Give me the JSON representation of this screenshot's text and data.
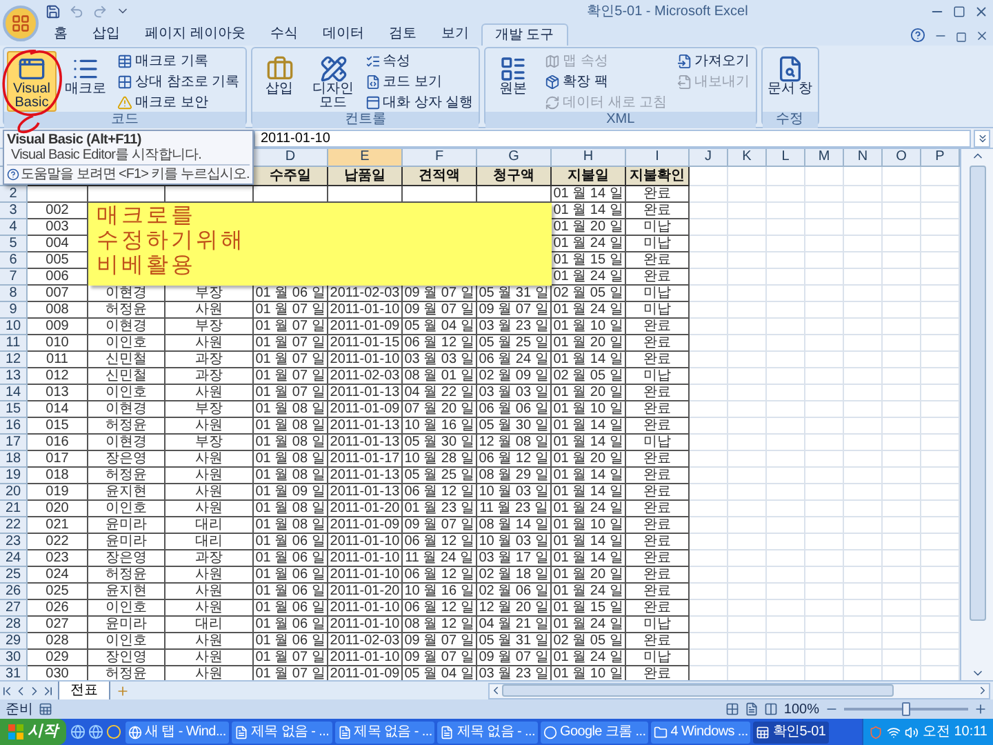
{
  "window": {
    "title": "확인5-01 - Microsoft Excel"
  },
  "ribbon_tabs": [
    {
      "label": "홈",
      "selected": false
    },
    {
      "label": "삽입",
      "selected": false
    },
    {
      "label": "페이지 레이아웃",
      "selected": false
    },
    {
      "label": "수식",
      "selected": false
    },
    {
      "label": "데이터",
      "selected": false
    },
    {
      "label": "검토",
      "selected": false
    },
    {
      "label": "보기",
      "selected": false
    },
    {
      "label": "개발 도구",
      "selected": true
    }
  ],
  "ribbon_groups": [
    {
      "label": "코드",
      "items": [
        {
          "kind": "large",
          "label": "Visual Basic",
          "hovered": true,
          "disabled": false
        },
        {
          "kind": "large",
          "label": "매크로",
          "hovered": false,
          "disabled": false
        },
        {
          "kind": "small",
          "label": "매크로 기록",
          "hovered": false,
          "disabled": false
        },
        {
          "kind": "small",
          "label": "상대 참조로 기록",
          "hovered": false,
          "disabled": false
        },
        {
          "kind": "small",
          "label": "매크로 보안",
          "hovered": false,
          "disabled": false
        }
      ]
    },
    {
      "label": "컨트롤",
      "items": [
        {
          "kind": "large",
          "label": "삽입",
          "hovered": false,
          "disabled": false
        },
        {
          "kind": "large",
          "label": "디자인 모드",
          "hovered": false,
          "disabled": false
        },
        {
          "kind": "small",
          "label": "속성",
          "hovered": false,
          "disabled": false
        },
        {
          "kind": "small",
          "label": "코드 보기",
          "hovered": false,
          "disabled": false
        },
        {
          "kind": "small",
          "label": "대화 상자 실행",
          "hovered": false,
          "disabled": false
        }
      ]
    },
    {
      "label": "XML",
      "items": [
        {
          "kind": "large",
          "label": "원본",
          "hovered": false,
          "disabled": false
        },
        {
          "kind": "small",
          "label": "맵 속성",
          "hovered": false,
          "disabled": true
        },
        {
          "kind": "small",
          "label": "확장 팩",
          "hovered": false,
          "disabled": false
        },
        {
          "kind": "small",
          "label": "데이터 새로 고침",
          "hovered": false,
          "disabled": true
        },
        {
          "kind": "small",
          "label": "가져오기",
          "hovered": false,
          "disabled": false
        },
        {
          "kind": "small",
          "label": "내보내기",
          "hovered": false,
          "disabled": true
        }
      ]
    },
    {
      "label": "수정",
      "items": [
        {
          "kind": "large",
          "label": "문서 창",
          "hovered": false,
          "disabled": false
        }
      ]
    }
  ],
  "tooltip": {
    "title": "Visual Basic (Alt+F11)",
    "description": "Visual Basic Editor를 시작합니다.",
    "help": "도움말을 보려면 <F1> 키를 누르십시오."
  },
  "formula_bar": {
    "value": "2011-01-10"
  },
  "column_headers": [
    {
      "label": "D",
      "selected": false
    },
    {
      "label": "E",
      "selected": true
    },
    {
      "label": "F",
      "selected": false
    },
    {
      "label": "G",
      "selected": false
    },
    {
      "label": "H",
      "selected": false
    },
    {
      "label": "I",
      "selected": false
    },
    {
      "label": "J",
      "selected": false
    },
    {
      "label": "K",
      "selected": false
    },
    {
      "label": "L",
      "selected": false
    },
    {
      "label": "M",
      "selected": false
    },
    {
      "label": "N",
      "selected": false
    },
    {
      "label": "O",
      "selected": false
    },
    {
      "label": "P",
      "selected": false
    }
  ],
  "table": {
    "columns": [
      "",
      "",
      "",
      "수주일",
      "납품일",
      "견적액",
      "청구액",
      "지불일",
      "지불확인"
    ],
    "rows": [
      {
        "number": "2",
        "cells": [
          null,
          null,
          null,
          null,
          null,
          null,
          null,
          "01 월 14 일",
          "완료"
        ]
      },
      {
        "number": "3",
        "cells": [
          "002",
          null,
          null,
          null,
          null,
          null,
          null,
          "01 월 14 일",
          "완료"
        ]
      },
      {
        "number": "4",
        "cells": [
          "003",
          null,
          null,
          null,
          null,
          null,
          null,
          "01 월 20 일",
          "미납"
        ]
      },
      {
        "number": "5",
        "cells": [
          "004",
          null,
          null,
          null,
          null,
          null,
          null,
          "01 월 24 일",
          "미납"
        ]
      },
      {
        "number": "6",
        "cells": [
          "005",
          null,
          null,
          null,
          null,
          null,
          null,
          "01 월 15 일",
          "완료"
        ]
      },
      {
        "number": "7",
        "cells": [
          "006",
          null,
          null,
          null,
          null,
          null,
          null,
          "01 월 24 일",
          "완료"
        ]
      },
      {
        "number": "8",
        "cells": [
          "007",
          "이현경",
          "부장",
          "01 월 06 일",
          "2011-02-03",
          "09 월 07 일",
          "05 월 31 일",
          "02 월 05 일",
          "미납"
        ]
      },
      {
        "number": "9",
        "cells": [
          "008",
          "허정윤",
          "사원",
          "01 월 07 일",
          "2011-01-10",
          "09 월 07 일",
          "09 월 07 일",
          "01 월 24 일",
          "미납"
        ]
      },
      {
        "number": "10",
        "cells": [
          "009",
          "이현경",
          "부장",
          "01 월 07 일",
          "2011-01-09",
          "05 월 04 일",
          "03 월 23 일",
          "01 월 10 일",
          "완료"
        ]
      },
      {
        "number": "11",
        "cells": [
          "010",
          "이인호",
          "사원",
          "01 월 07 일",
          "2011-01-15",
          "06 월 12 일",
          "05 월 25 일",
          "01 월 20 일",
          "완료"
        ]
      },
      {
        "number": "12",
        "cells": [
          "011",
          "신민철",
          "과장",
          "01 월 07 일",
          "2011-01-10",
          "03 월 03 일",
          "06 월 24 일",
          "01 월 14 일",
          "완료"
        ]
      },
      {
        "number": "13",
        "cells": [
          "012",
          "신민철",
          "과장",
          "01 월 07 일",
          "2011-02-03",
          "08 월 01 일",
          "02 월 09 일",
          "02 월 05 일",
          "미납"
        ]
      },
      {
        "number": "14",
        "cells": [
          "013",
          "이인호",
          "사원",
          "01 월 07 일",
          "2011-01-13",
          "04 월 22 일",
          "03 월 03 일",
          "01 월 20 일",
          "완료"
        ]
      },
      {
        "number": "15",
        "cells": [
          "014",
          "이현경",
          "부장",
          "01 월 08 일",
          "2011-01-09",
          "07 월 20 일",
          "06 월 06 일",
          "01 월 10 일",
          "완료"
        ]
      },
      {
        "number": "16",
        "cells": [
          "015",
          "허정윤",
          "사원",
          "01 월 08 일",
          "2011-01-13",
          "10 월 16 일",
          "05 월 30 일",
          "01 월 14 일",
          "완료"
        ]
      },
      {
        "number": "17",
        "cells": [
          "016",
          "이현경",
          "부장",
          "01 월 08 일",
          "2011-01-13",
          "05 월 30 일",
          "12 월 08 일",
          "01 월 14 일",
          "미납"
        ]
      },
      {
        "number": "18",
        "cells": [
          "017",
          "장은영",
          "사원",
          "01 월 08 일",
          "2011-01-17",
          "10 월 28 일",
          "06 월 12 일",
          "01 월 20 일",
          "완료"
        ]
      },
      {
        "number": "19",
        "cells": [
          "018",
          "허정윤",
          "사원",
          "01 월 08 일",
          "2011-01-13",
          "05 월 25 일",
          "08 월 29 일",
          "01 월 14 일",
          "완료"
        ]
      },
      {
        "number": "20",
        "cells": [
          "019",
          "윤지현",
          "사원",
          "01 월 09 일",
          "2011-01-13",
          "06 월 12 일",
          "10 월 03 일",
          "01 월 14 일",
          "완료"
        ]
      },
      {
        "number": "21",
        "cells": [
          "020",
          "이인호",
          "사원",
          "01 월 08 일",
          "2011-01-20",
          "01 월 23 일",
          "11 월 23 일",
          "01 월 24 일",
          "완료"
        ]
      },
      {
        "number": "22",
        "cells": [
          "021",
          "윤미라",
          "대리",
          "01 월 08 일",
          "2011-01-09",
          "09 월 07 일",
          "08 월 14 일",
          "01 월 10 일",
          "완료"
        ]
      },
      {
        "number": "23",
        "cells": [
          "022",
          "윤미라",
          "대리",
          "01 월 06 일",
          "2011-01-10",
          "06 월 12 일",
          "10 월 03 일",
          "01 월 14 일",
          "완료"
        ]
      },
      {
        "number": "24",
        "cells": [
          "023",
          "장은영",
          "과장",
          "01 월 06 일",
          "2011-01-10",
          "11 월 24 일",
          "03 월 17 일",
          "01 월 14 일",
          "완료"
        ]
      },
      {
        "number": "25",
        "cells": [
          "024",
          "허정윤",
          "사원",
          "01 월 06 일",
          "2011-01-10",
          "06 월 12 일",
          "02 월 18 일",
          "01 월 20 일",
          "완료"
        ]
      },
      {
        "number": "26",
        "cells": [
          "025",
          "윤지현",
          "사원",
          "01 월 06 일",
          "2011-01-20",
          "10 월 16 일",
          "02 월 06 일",
          "01 월 24 일",
          "완료"
        ]
      },
      {
        "number": "27",
        "cells": [
          "026",
          "이인호",
          "사원",
          "01 월 06 일",
          "2011-01-10",
          "06 월 12 일",
          "12 월 20 일",
          "01 월 15 일",
          "완료"
        ]
      },
      {
        "number": "28",
        "cells": [
          "027",
          "윤미라",
          "대리",
          "01 월 06 일",
          "2011-01-10",
          "08 월 12 일",
          "04 월 21 일",
          "01 월 24 일",
          "미납"
        ]
      },
      {
        "number": "29",
        "cells": [
          "028",
          "이인호",
          "사원",
          "01 월 06 일",
          "2011-02-03",
          "09 월 07 일",
          "05 월 31 일",
          "02 월 05 일",
          "완료"
        ]
      },
      {
        "number": "30",
        "cells": [
          "029",
          "장인영",
          "사원",
          "01 월 07 일",
          "2011-01-10",
          "09 월 07 일",
          "09 월 07 일",
          "01 월 24 일",
          "미납"
        ]
      },
      {
        "number": "31",
        "cells": [
          "030",
          "허정윤",
          "사원",
          "01 월 07 일",
          "2011-01-09",
          "05 월 04 일",
          "03 월 23 일",
          "01 월 10 일",
          "완료"
        ]
      }
    ]
  },
  "note": {
    "lines": [
      "매크로를",
      "수정하기위해",
      "비베활용"
    ]
  },
  "sheet_tabs": [
    {
      "label": "전표",
      "selected": true
    }
  ],
  "status_bar": {
    "status": "준비",
    "zoom": "100%",
    "zoom_slider": {
      "level": 0.5
    }
  },
  "taskbar": {
    "start": "시작",
    "tasks": [
      {
        "label": "새 탭 - Wind...",
        "selected": false
      },
      {
        "label": "제목 없음 - ...",
        "selected": false
      },
      {
        "label": "제목 없음 - ...",
        "selected": false
      },
      {
        "label": "제목 없음 - ...",
        "selected": false
      },
      {
        "label": "Google 크롬 ...",
        "selected": false
      },
      {
        "label": "4 Windows ...",
        "selected": false
      },
      {
        "label": "확인5-01",
        "selected": true
      }
    ],
    "clock": "오전 10:11"
  }
}
